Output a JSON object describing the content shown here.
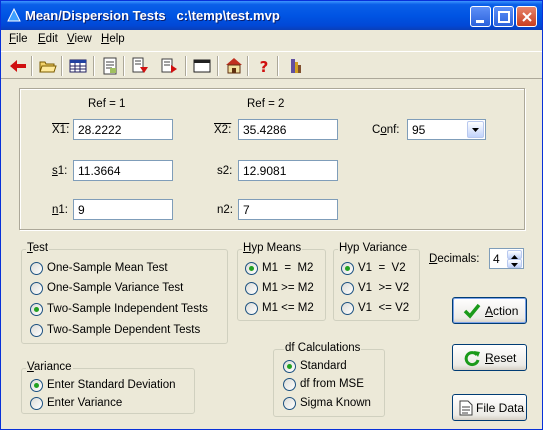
{
  "window": {
    "title": "Mean/Dispersion Tests   c:\\temp\\test.mvp"
  },
  "menu": [
    {
      "name": "menu-file",
      "u": "F",
      "rest": "ile"
    },
    {
      "name": "menu-edit",
      "u": "E",
      "rest": "dit"
    },
    {
      "name": "menu-view",
      "u": "V",
      "rest": "iew"
    },
    {
      "name": "menu-help",
      "u": "H",
      "rest": "elp"
    }
  ],
  "inputs": {
    "ref1_label": "Ref = 1",
    "ref2_label": "Ref = 2",
    "x1_label": "X1:",
    "x1_value": "28.2222",
    "x2_label": "X2:",
    "x2_value": "35.4286",
    "s1_label_u": "s",
    "s1_label_rest": "1:",
    "s1_value": "11.3664",
    "s2_label": "s2:",
    "s2_value": "12.9081",
    "n1_label_u": "n",
    "n1_label_rest": "1:",
    "n1_value": "9",
    "n2_label": "n2:",
    "n2_value": "7",
    "conf_label_pre": "C",
    "conf_label_u": "o",
    "conf_label_rest": "nf:",
    "conf_value": "95"
  },
  "test_group": {
    "title_u": "T",
    "title_rest": "est",
    "options": [
      "One-Sample Mean Test",
      "One-Sample Variance Test",
      "Two-Sample Independent Tests",
      "Two-Sample Dependent Tests"
    ],
    "selected": 2
  },
  "hyp_means": {
    "title_u": "H",
    "title_rest": "yp Means",
    "options": [
      "M1  =  M2",
      "M1 >= M2",
      "M1 <= M2"
    ],
    "selected": 0
  },
  "hyp_variance": {
    "title": "Hyp Variance",
    "options": [
      "V1  =  V2",
      "V1  >= V2",
      "V1  <= V2"
    ],
    "selected": 0
  },
  "decimals": {
    "label_u": "D",
    "label_rest": "ecimals:",
    "value": "4"
  },
  "variance_group": {
    "title_u": "V",
    "title_rest": "ariance",
    "options": [
      "Enter Standard Deviation",
      "Enter Variance"
    ],
    "selected": 0
  },
  "df_group": {
    "title": "df Calculations",
    "options": [
      "Standard",
      "df from MSE",
      "Sigma Known"
    ],
    "selected": 0
  },
  "buttons": {
    "action_u": "A",
    "action_rest": "ction",
    "reset_u": "R",
    "reset_rest": "eset",
    "filedata": "File Data"
  }
}
